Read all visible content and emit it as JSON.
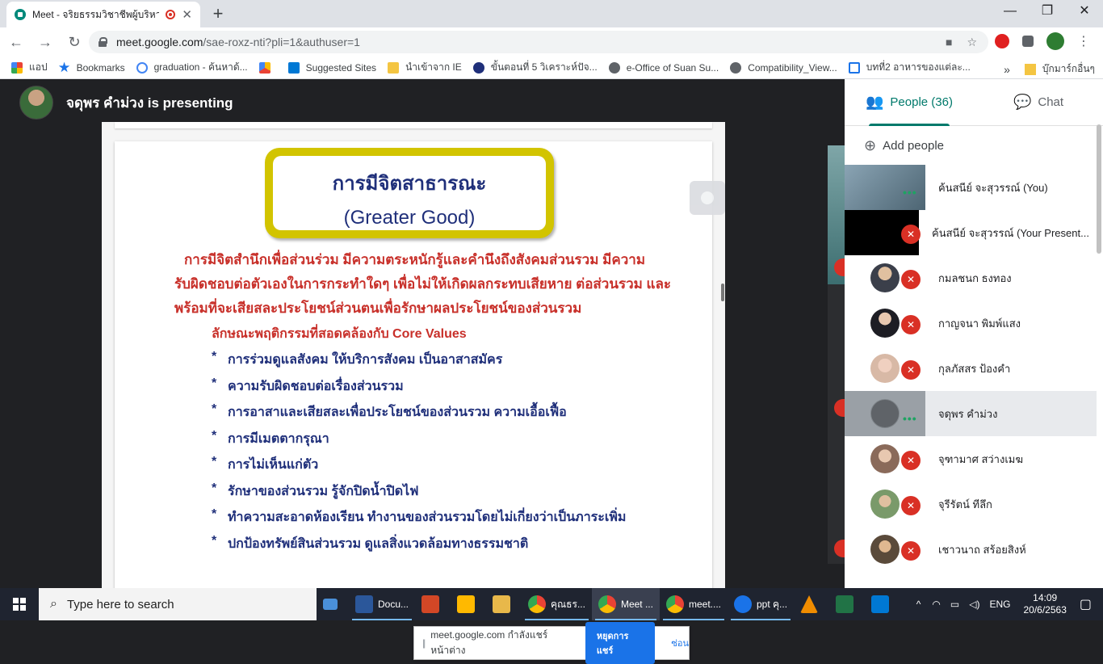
{
  "browser": {
    "tab_title": "Meet - จริยธรรมวิชาชีพผู้บริหาร",
    "tab_close": "✕",
    "new_tab": "+",
    "window_controls": [
      "—",
      "❐",
      "✕"
    ],
    "url_host": "meet.google.com",
    "url_path": "/sae-roxz-nti?pli=1&authuser=1",
    "nav": {
      "back": "←",
      "forward": "→",
      "reload": "↻"
    },
    "bookmarks": [
      {
        "label": "แอป",
        "color": "#ea4335"
      },
      {
        "label": "Bookmarks",
        "color": "#1a73e8"
      },
      {
        "label": "graduation - ค้นหาด้...",
        "color": "#4285f4"
      },
      {
        "label": "",
        "color": "#fbbc04"
      },
      {
        "label": "Suggested Sites",
        "color": "#0078d4"
      },
      {
        "label": "นำเข้าจาก IE",
        "color": "#f4c542"
      },
      {
        "label": "ขั้นตอนที่ 5 วิเคราะห์ปัจ...",
        "color": "#1f2f7a"
      },
      {
        "label": "e-Office of Suan Su...",
        "color": "#5f6368"
      },
      {
        "label": "Compatibility_View...",
        "color": "#5f6368"
      },
      {
        "label": "บทที่2 อาหารของแต่ละ...",
        "color": "#1a73e8"
      }
    ],
    "bookmarks_more": "»",
    "other_bookmarks": "บุ๊กมาร์กอื่นๆ"
  },
  "meet": {
    "presenting_label": "จดุพร คำม่วง is presenting",
    "share_bar": {
      "text": "meet.google.com กำลังแชร์หน้าต่าง",
      "stop_label": "หยุดการแชร์",
      "hide_label": "ซ่อน"
    }
  },
  "slide": {
    "title_th": "การมีจิตสาธารณะ",
    "title_en": "(Greater Good)",
    "paragraph": [
      "การมีจิตสำนึกเพื่อส่วนร่วม มีความตระหนักรู้และคำนึงถึงสังคมส่วนรวม มีความ",
      "รับผิดชอบต่อตัวเองในการกระทำใดๆ เพื่อไม่ให้เกิดผลกระทบเสียหาย ต่อส่วนรวม และ",
      "พร้อมที่จะเสียสละประโยชน์ส่วนตนเพื่อรักษาผลประโยชน์ของส่วนรวม"
    ],
    "subheading": "ลักษณะพฤติกรรมที่สอดคล้องกับ Core Values",
    "bullet_marker": "*",
    "bullets": [
      "การร่วมดูแลสังคม ให้บริการสังคม เป็นอาสาสมัคร",
      "ความรับผิดชอบต่อเรื่องส่วนรวม",
      "การอาสาและเสียสละเพื่อประโยชน์ของส่วนรวม ความเอื้อเฟื้อ",
      "การมีเมตตากรุณา",
      "การไม่เห็นแก่ตัว",
      "รักษาของส่วนรวม รู้จักปิดน้ำปิดไฟ",
      "ทำความสะอาดห้องเรียน ทำงานของส่วนรวมโดยไม่เกี่ยงว่าเป็นภาระเพิ่ม",
      "ปกป้องทรัพย์สินส่วนรวม ดูแลสิ่งแวดล้อมทางธรรมชาติ"
    ]
  },
  "panel": {
    "people_tab": "People (36)",
    "chat_tab": "Chat",
    "add_people": "Add people",
    "participants": [
      {
        "name": "ค้นสนีย์ จะสุวรรณ์ (You)",
        "state": "speaking",
        "color": "#6f8a9a"
      },
      {
        "name": "ค้นสนีย์ จะสุวรรณ์ (Your Present...",
        "state": "muted",
        "color": "#111111"
      },
      {
        "name": "กมลชนก ธงทอง",
        "state": "muted",
        "color": "#3b3f4a"
      },
      {
        "name": "กาญจนา พิมพ์แสง",
        "state": "muted",
        "color": "#1d1d24"
      },
      {
        "name": "กุลภัสสร ป้องคำ",
        "state": "muted",
        "color": "#d8b9a6"
      },
      {
        "name": "จดุพร คำม่วง",
        "state": "presenting",
        "color": "#5f6368"
      },
      {
        "name": "จุฑามาศ สว่างเมฆ",
        "state": "muted",
        "color": "#8a6a5a"
      },
      {
        "name": "จุรีรัตน์ ทีลึก",
        "state": "muted",
        "color": "#7a9a6a"
      },
      {
        "name": "เชาวนาถ สร้อยสิงห์",
        "state": "muted",
        "color": "#5a4a3a"
      }
    ]
  },
  "taskbar": {
    "search_placeholder": "Type here to search",
    "apps": [
      {
        "label": "",
        "color": "#4a90d9"
      },
      {
        "label": "Docu...",
        "color": "#2b579a"
      },
      {
        "label": "",
        "color": "#d24726"
      },
      {
        "label": "",
        "color": "#ffb900"
      },
      {
        "label": "",
        "color": "#e8b84a"
      },
      {
        "label": "คุณธร...",
        "color": "#ea4335"
      },
      {
        "label": "Meet ...",
        "color": "#ea4335"
      },
      {
        "label": "meet....",
        "color": "#ea4335"
      },
      {
        "label": "ppt คุ...",
        "color": "#1a73e8"
      },
      {
        "label": "",
        "color": "#f08c00"
      },
      {
        "label": "",
        "color": "#217346"
      },
      {
        "label": "",
        "color": "#0078d4"
      }
    ],
    "language": "ENG",
    "time": "14:09",
    "date": "20/6/2563"
  }
}
